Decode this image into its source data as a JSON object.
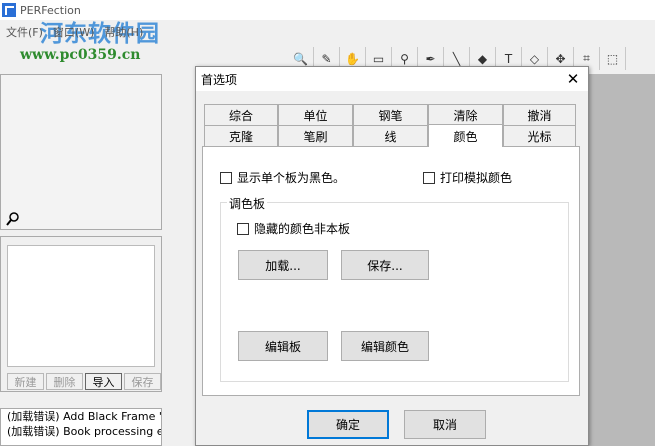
{
  "app": {
    "title": "PERFection",
    "watermark_title": "河东软件园",
    "watermark_url": "www.pc0359.cn",
    "menus": [
      "文件(F)",
      "窗口(W)",
      "帮助(H)"
    ]
  },
  "toolbar": {
    "tools": [
      {
        "name": "zoom-tool-icon",
        "glyph": "🔍"
      },
      {
        "name": "eyedropper-tool-icon",
        "glyph": "✎"
      },
      {
        "name": "hand-tool-icon",
        "glyph": "✋"
      },
      {
        "name": "ruler-tool-icon",
        "glyph": "▭"
      },
      {
        "name": "stamp-tool-icon",
        "glyph": "⚲"
      },
      {
        "name": "pen-tool-icon",
        "glyph": "✒"
      },
      {
        "name": "line-tool-icon",
        "glyph": "╲"
      },
      {
        "name": "eraser-tool-icon",
        "glyph": "◆"
      },
      {
        "name": "text-tool-icon",
        "glyph": "T"
      },
      {
        "name": "shape-tool-icon",
        "glyph": "◇"
      },
      {
        "name": "move-tool-icon",
        "glyph": "✥"
      },
      {
        "name": "crop-tool-icon",
        "glyph": "⌗"
      },
      {
        "name": "select-tool-icon",
        "glyph": "⬚"
      }
    ]
  },
  "left_panel": {
    "buttons": [
      "新建",
      "删除",
      "导入",
      "保存"
    ],
    "log": [
      "(加载错误) Add Black Frame '",
      "(加载错误) Book processing e"
    ]
  },
  "dialog": {
    "title": "首选项",
    "close_glyph": "✕",
    "tabs_row1": [
      "综合",
      "单位",
      "钢笔",
      "清除",
      "撤消"
    ],
    "tabs_row2": [
      "克隆",
      "笔刷",
      "线",
      "颜色",
      "光标"
    ],
    "selected_tab": "颜色",
    "show_black_label": "显示单个板为黑色。",
    "print_sim_label": "打印模拟颜色",
    "palette_group": "调色板",
    "hidden_colors_label": "隐藏的颜色非本板",
    "load_button": "加载...",
    "save_button": "保存...",
    "edit_board_button": "编辑板",
    "edit_color_button": "编辑颜色",
    "ok_button": "确定",
    "cancel_button": "取消"
  }
}
